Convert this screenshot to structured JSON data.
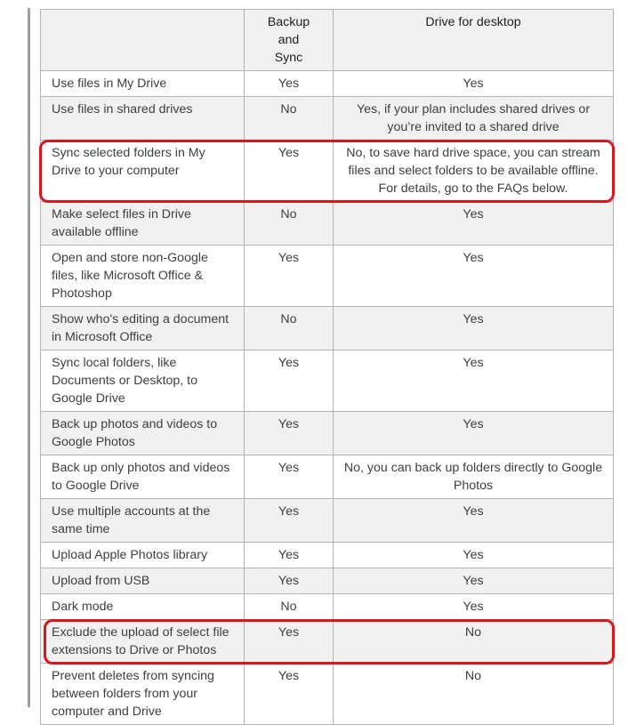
{
  "table": {
    "headers": [
      "",
      "Backup and Sync",
      "Drive for desktop"
    ],
    "rows": [
      {
        "feature": "Use files in My Drive",
        "backup_and_sync": "Yes",
        "drive_for_desktop": "Yes",
        "highlighted": false
      },
      {
        "feature": "Use files in shared drives",
        "backup_and_sync": "No",
        "drive_for_desktop": "Yes, if your plan includes shared drives or you’re invited to a shared drive",
        "highlighted": false
      },
      {
        "feature": "Sync selected folders in My Drive to your computer",
        "backup_and_sync": "Yes",
        "drive_for_desktop": "No, to save hard drive space, you can stream files and select folders to be available offline. For details, go to the FAQs below.",
        "highlighted": true
      },
      {
        "feature": "Make select files in Drive available offline",
        "backup_and_sync": "No",
        "drive_for_desktop": "Yes",
        "highlighted": false
      },
      {
        "feature": "Open and store non-Google files, like Microsoft Office & Photoshop",
        "backup_and_sync": "Yes",
        "drive_for_desktop": "Yes",
        "highlighted": false
      },
      {
        "feature": "Show who's editing a document in Microsoft Office",
        "backup_and_sync": "No",
        "drive_for_desktop": "Yes",
        "highlighted": false
      },
      {
        "feature": "Sync local folders, like Documents or Desktop, to Google Drive",
        "backup_and_sync": "Yes",
        "drive_for_desktop": "Yes",
        "highlighted": false
      },
      {
        "feature": "Back up photos and videos to Google Photos",
        "backup_and_sync": "Yes",
        "drive_for_desktop": "Yes",
        "highlighted": false
      },
      {
        "feature": "Back up only photos and videos to Google Drive",
        "backup_and_sync": "Yes",
        "drive_for_desktop": "No, you can back up folders directly to Google Photos",
        "highlighted": false
      },
      {
        "feature": "Use multiple accounts at the same time",
        "backup_and_sync": "Yes",
        "drive_for_desktop": "Yes",
        "highlighted": false
      },
      {
        "feature": "Upload Apple Photos library",
        "backup_and_sync": "Yes",
        "drive_for_desktop": "Yes",
        "highlighted": false
      },
      {
        "feature": "Upload from USB",
        "backup_and_sync": "Yes",
        "drive_for_desktop": "Yes",
        "highlighted": false
      },
      {
        "feature": "Dark mode",
        "backup_and_sync": "No",
        "drive_for_desktop": "Yes",
        "highlighted": false
      },
      {
        "feature": "Exclude the upload of select file extensions to Drive or Photos",
        "backup_and_sync": "Yes",
        "drive_for_desktop": "No",
        "highlighted": true
      },
      {
        "feature": "Prevent deletes from syncing between folders from your computer and Drive",
        "backup_and_sync": "Yes",
        "drive_for_desktop": "No",
        "highlighted": false
      }
    ]
  },
  "highlight_color": "#d6171c"
}
